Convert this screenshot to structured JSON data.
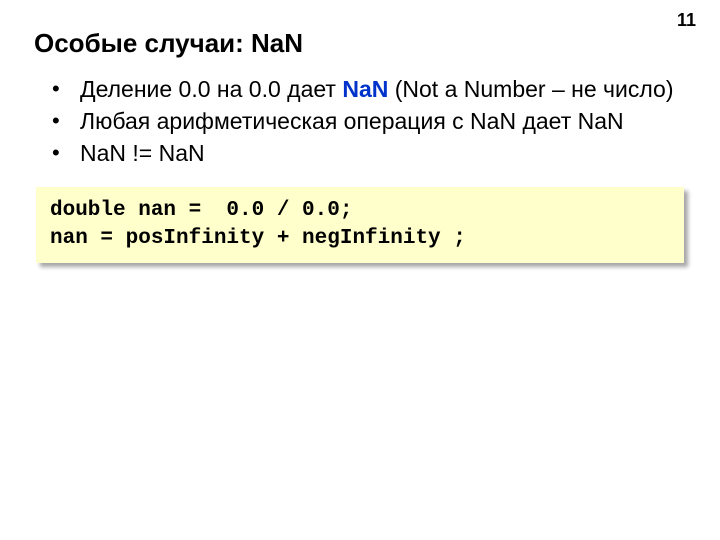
{
  "page": {
    "number": "11"
  },
  "title": "Особые случаи: NaN",
  "bullets": [
    {
      "pre": "Деление 0.0 на 0.0 дает ",
      "hl": "NaN",
      "post": " (Not a Number – не число)"
    },
    {
      "text": "Любая арифметическая операция с NaN дает NaN"
    },
    {
      "text": "NaN != NaN"
    }
  ],
  "code": {
    "line1": "double nan =  0.0 / 0.0;",
    "line2": "nan = posInfinity + negInfinity ;"
  },
  "colors": {
    "highlight": "#0033cc",
    "codeBg": "#ffffcc"
  }
}
